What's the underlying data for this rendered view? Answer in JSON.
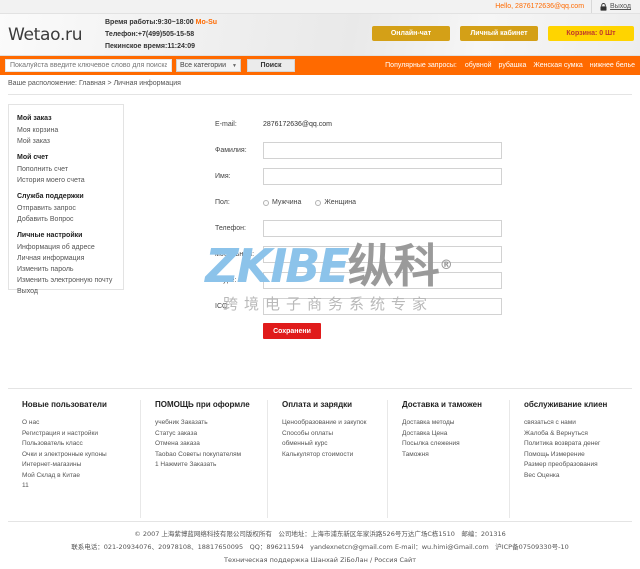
{
  "topbar": {
    "hello": "Hello, 2876172636@qq.com",
    "logout": "Выход",
    "lock_icon": "lock-icon"
  },
  "header": {
    "logo": "Wetao.ru",
    "hours_label": "Время работы:9:30~18:00 ",
    "hours_days": "Mo-Su",
    "phone": "Телефон:+7(499)505-15-58",
    "beijing_time": "Пекинское время:11:24:09",
    "buttons": [
      {
        "label": "Онлайн-чат",
        "name": "online-chat-button"
      },
      {
        "label": "Личный кабинет",
        "name": "personal-account-button"
      },
      {
        "label": "Корзина: 0 Шт",
        "name": "cart-button"
      }
    ]
  },
  "search": {
    "placeholder": "Покалуйста введите ключевое слово для поиска",
    "value": "",
    "category": "Все категории",
    "chevron": "▼",
    "button": "Поиск",
    "popular_label": "Популярные запросы:",
    "popular_items": [
      "обувной",
      "рубашка",
      "Женская сумка",
      "нижнее белье"
    ]
  },
  "breadcrumb": "Ваше расположение: Главная > Личная информация",
  "sidebar": {
    "groups": [
      {
        "title": "Мой заказ",
        "items": [
          "Моя корзина",
          "Мой заказ"
        ]
      },
      {
        "title": "Мой счет",
        "items": [
          "Пополнить счет",
          "История моего счета"
        ]
      },
      {
        "title": "Служба поддержки",
        "items": [
          "Отправить запрос",
          "Добавить Вопрос"
        ]
      },
      {
        "title": "Личные настройки",
        "items": [
          "Информация об адресе",
          "Личная информация",
          "Изменить пароль",
          "Изменить электронную почту",
          "Выход"
        ]
      }
    ]
  },
  "form": {
    "email_label": "E-mail:",
    "email_value": "2876172636@qq.com",
    "surname_label": "Фамилия:",
    "surname_value": "",
    "name_label": "Имя:",
    "name_value": "",
    "gender_label": "Пол:",
    "gender_male": "Мужчина",
    "gender_female": "Женщина",
    "phone_label": "Телефон:",
    "phone_value": "",
    "mobile_label": "мобильный:",
    "mobile_value": "",
    "skype_label": "Skype:",
    "skype_value": "",
    "icq_label": "ICQ:",
    "icq_value": "",
    "save_label": "Сохранени"
  },
  "watermark": {
    "latin": "ZKIBE",
    "cn": "纵科",
    "reg": "®",
    "sub": "跨境电子商务系统专家"
  },
  "footer": {
    "columns": [
      {
        "title": "Новые пользователи",
        "items": [
          "О нас",
          "Регистрация и настройки",
          "Пользователь класс",
          "Очки и электронные купоны",
          "Интернет-магазины",
          "Мой Склад в Китае",
          "11"
        ]
      },
      {
        "title": "ПОМОЩЬ при оформле",
        "items": [
          "учебник Заказать",
          "Статус заказа",
          "Отмена заказа",
          "Taobao Советы покупателям",
          "1 Нажмите Заказать"
        ]
      },
      {
        "title": "Оплата и зарядки",
        "items": [
          "Ценообразование и закупок",
          "Способы оплаты",
          "обменный курс",
          "Калькулятор стоимости"
        ]
      },
      {
        "title": "Доставка и таможен",
        "items": [
          "Доставка методы",
          "Доставка Цена",
          "Посылка слежения",
          "Таможня"
        ]
      },
      {
        "title": "обслуживание клиен",
        "items": [
          "связаться с нами",
          "Жалоба & Вернуться",
          "Политика возврата денег",
          "Помощь Измерение",
          "Размер преобразования",
          "Вес Оценка"
        ]
      }
    ]
  },
  "copyright": {
    "line1": "© 2007 上海紫博蓝网络科技有限公司版权所有　公司地址：上海市浦东新区年家浜路526号万达广场C栋1510　邮编：201316",
    "line2": "联系电话：021-20934076、20978108、18817650095　QQ：896211594　yandexnetcn@gmail.com E-mail：wu.himi@Gmail.com　沪ICP备07509330号-10",
    "line3": "Техническая поддержка Шанхай ZiБоЛан / Россия Сайт"
  }
}
